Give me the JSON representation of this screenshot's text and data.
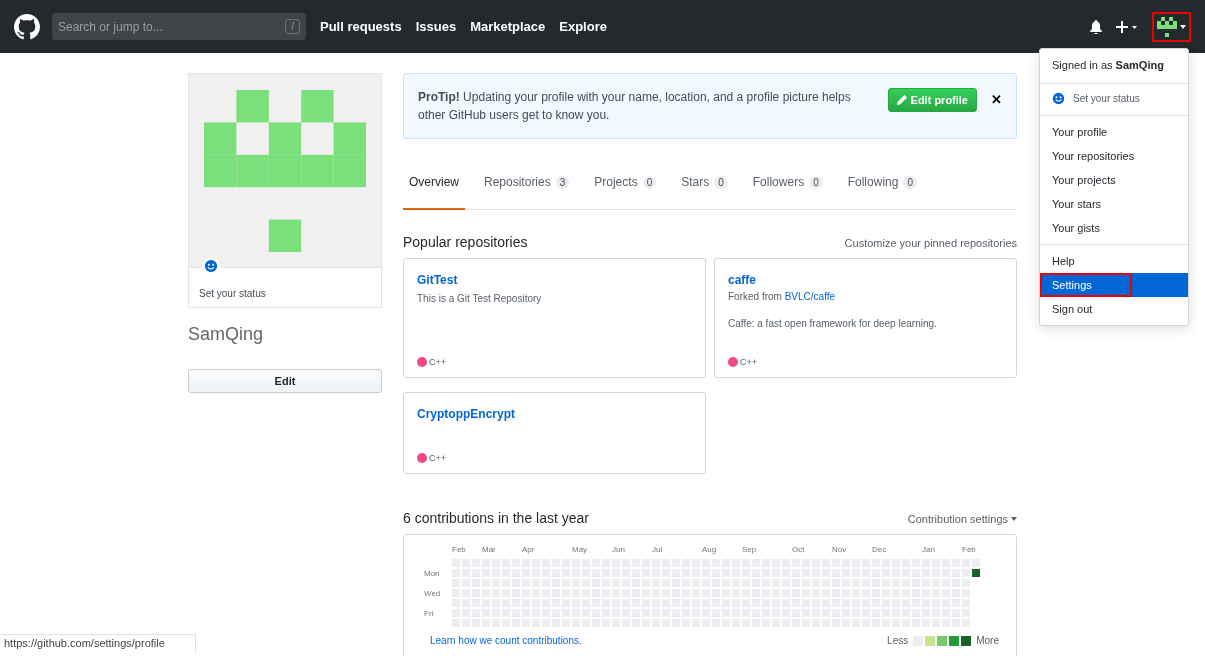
{
  "header": {
    "search": {
      "placeholder": "Search or jump to...",
      "shortcut": "/"
    },
    "nav": [
      "Pull requests",
      "Issues",
      "Marketplace",
      "Explore"
    ],
    "avatar_annotated": true
  },
  "user_menu": {
    "signed_in": "Signed in as **SamQing**",
    "status": "Set your status",
    "sections": [
      [
        {
          "label": "Your profile",
          "selected": false,
          "annotated": false
        },
        {
          "label": "Your repositories",
          "selected": false,
          "annotated": false
        },
        {
          "label": "Your projects",
          "selected": false,
          "annotated": false
        },
        {
          "label": "Your stars",
          "selected": false,
          "annotated": false
        },
        {
          "label": "Your gists",
          "selected": false,
          "annotated": false
        }
      ],
      [
        {
          "label": "Help",
          "selected": false,
          "annotated": false
        },
        {
          "label": "Settings",
          "selected": true,
          "annotated": true
        },
        {
          "label": "Sign out",
          "selected": false,
          "annotated": false
        }
      ]
    ]
  },
  "profile": {
    "status": "Set your status",
    "name": "SamQing",
    "edit_button": "Edit"
  },
  "protip": {
    "text": "**ProTip!** Updating your profile with your name, location, and a profile picture helps other GitHub users get to know you.",
    "button": "Edit profile",
    "close": "✕"
  },
  "tabs": [
    {
      "label": "Overview",
      "selected": true
    },
    {
      "label": "Repositories",
      "count": "3",
      "selected": false
    },
    {
      "label": "Projects",
      "count": "0",
      "selected": false
    },
    {
      "label": "Stars",
      "count": "0",
      "selected": false
    },
    {
      "label": "Followers",
      "count": "0",
      "selected": false
    },
    {
      "label": "Following",
      "count": "0",
      "selected": false
    }
  ],
  "pinned": {
    "title": "Popular repositories",
    "customize": "Customize your pinned repositories",
    "repos": [
      {
        "name": "GitTest",
        "description": "This is a Git Test Repository",
        "language": "C++",
        "color": "#f34b7d"
      },
      {
        "name": "caffe",
        "fork_prefix": "Forked from",
        "fork_source": "BVLC/caffe",
        "description": "Caffe: a fast open framework for deep learning.",
        "language": "C++",
        "color": "#f34b7d"
      },
      {
        "name": "CryptoppEncrypt",
        "language": "C++",
        "color": "#f34b7d"
      }
    ]
  },
  "contributions": {
    "title": "6 contributions in the last year",
    "settings": "Contribution settings",
    "months": [
      "Feb",
      "Mar",
      "Apr",
      "May",
      "Jun",
      "Jul",
      "Aug",
      "Sep",
      "Oct",
      "Nov",
      "Dec",
      "Jan",
      "Feb"
    ],
    "days": [
      "Mon",
      "Wed",
      "Fri"
    ],
    "learn": "Learn how we count contributions.",
    "less": "Less",
    "more": "More"
  },
  "status_url": "https://github.com/settings/profile"
}
